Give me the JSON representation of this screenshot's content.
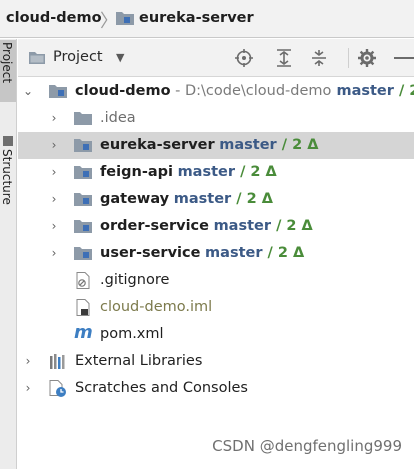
{
  "breadcrumb": {
    "project": "cloud-demo",
    "separator": "〉",
    "module": "eureka-server"
  },
  "side_tabs": {
    "project": "Project",
    "structure": "Structure"
  },
  "pane": {
    "title": "Project",
    "dropdown": "▼",
    "icons": [
      "locate-icon",
      "expand-all-icon",
      "collapse-all-icon",
      "settings-gear-icon",
      "hide-icon"
    ]
  },
  "tree": {
    "root": {
      "name": "cloud-demo",
      "path": " - D:\\code\\cloud-demo",
      "branch": " master",
      "delta": " / 2"
    },
    "idea": ".idea",
    "modules": [
      {
        "name": "eureka-server",
        "branch": "master",
        "delta": " / 2 Δ"
      },
      {
        "name": "feign-api",
        "branch": "master",
        "delta": " / 2 Δ"
      },
      {
        "name": "gateway",
        "branch": "master",
        "delta": " / 2 Δ"
      },
      {
        "name": "order-service",
        "branch": "master",
        "delta": " / 2 Δ"
      },
      {
        "name": "user-service",
        "branch": "master",
        "delta": " / 2 Δ"
      }
    ],
    "gitignore": ".gitignore",
    "iml": "cloud-demo.iml",
    "pom_icon": "m",
    "pom": "pom.xml",
    "external_libraries": "External Libraries",
    "scratches": "Scratches and Consoles"
  },
  "colors": {
    "branch": "#3c5a86",
    "delta": "#4a8c3a",
    "folder": "#8d9aa8",
    "selection": "#d5d5d5"
  },
  "watermark": "CSDN @dengfengling999"
}
